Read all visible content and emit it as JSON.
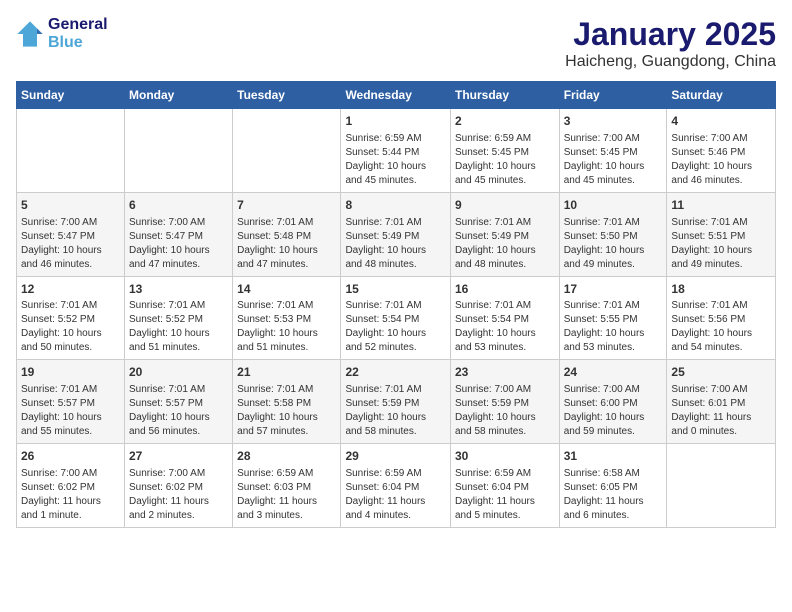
{
  "logo": {
    "line1": "General",
    "line2": "Blue"
  },
  "title": "January 2025",
  "subtitle": "Haicheng, Guangdong, China",
  "days_of_week": [
    "Sunday",
    "Monday",
    "Tuesday",
    "Wednesday",
    "Thursday",
    "Friday",
    "Saturday"
  ],
  "weeks": [
    [
      {
        "day": "",
        "info": ""
      },
      {
        "day": "",
        "info": ""
      },
      {
        "day": "",
        "info": ""
      },
      {
        "day": "1",
        "info": "Sunrise: 6:59 AM\nSunset: 5:44 PM\nDaylight: 10 hours\nand 45 minutes."
      },
      {
        "day": "2",
        "info": "Sunrise: 6:59 AM\nSunset: 5:45 PM\nDaylight: 10 hours\nand 45 minutes."
      },
      {
        "day": "3",
        "info": "Sunrise: 7:00 AM\nSunset: 5:45 PM\nDaylight: 10 hours\nand 45 minutes."
      },
      {
        "day": "4",
        "info": "Sunrise: 7:00 AM\nSunset: 5:46 PM\nDaylight: 10 hours\nand 46 minutes."
      }
    ],
    [
      {
        "day": "5",
        "info": "Sunrise: 7:00 AM\nSunset: 5:47 PM\nDaylight: 10 hours\nand 46 minutes."
      },
      {
        "day": "6",
        "info": "Sunrise: 7:00 AM\nSunset: 5:47 PM\nDaylight: 10 hours\nand 47 minutes."
      },
      {
        "day": "7",
        "info": "Sunrise: 7:01 AM\nSunset: 5:48 PM\nDaylight: 10 hours\nand 47 minutes."
      },
      {
        "day": "8",
        "info": "Sunrise: 7:01 AM\nSunset: 5:49 PM\nDaylight: 10 hours\nand 48 minutes."
      },
      {
        "day": "9",
        "info": "Sunrise: 7:01 AM\nSunset: 5:49 PM\nDaylight: 10 hours\nand 48 minutes."
      },
      {
        "day": "10",
        "info": "Sunrise: 7:01 AM\nSunset: 5:50 PM\nDaylight: 10 hours\nand 49 minutes."
      },
      {
        "day": "11",
        "info": "Sunrise: 7:01 AM\nSunset: 5:51 PM\nDaylight: 10 hours\nand 49 minutes."
      }
    ],
    [
      {
        "day": "12",
        "info": "Sunrise: 7:01 AM\nSunset: 5:52 PM\nDaylight: 10 hours\nand 50 minutes."
      },
      {
        "day": "13",
        "info": "Sunrise: 7:01 AM\nSunset: 5:52 PM\nDaylight: 10 hours\nand 51 minutes."
      },
      {
        "day": "14",
        "info": "Sunrise: 7:01 AM\nSunset: 5:53 PM\nDaylight: 10 hours\nand 51 minutes."
      },
      {
        "day": "15",
        "info": "Sunrise: 7:01 AM\nSunset: 5:54 PM\nDaylight: 10 hours\nand 52 minutes."
      },
      {
        "day": "16",
        "info": "Sunrise: 7:01 AM\nSunset: 5:54 PM\nDaylight: 10 hours\nand 53 minutes."
      },
      {
        "day": "17",
        "info": "Sunrise: 7:01 AM\nSunset: 5:55 PM\nDaylight: 10 hours\nand 53 minutes."
      },
      {
        "day": "18",
        "info": "Sunrise: 7:01 AM\nSunset: 5:56 PM\nDaylight: 10 hours\nand 54 minutes."
      }
    ],
    [
      {
        "day": "19",
        "info": "Sunrise: 7:01 AM\nSunset: 5:57 PM\nDaylight: 10 hours\nand 55 minutes."
      },
      {
        "day": "20",
        "info": "Sunrise: 7:01 AM\nSunset: 5:57 PM\nDaylight: 10 hours\nand 56 minutes."
      },
      {
        "day": "21",
        "info": "Sunrise: 7:01 AM\nSunset: 5:58 PM\nDaylight: 10 hours\nand 57 minutes."
      },
      {
        "day": "22",
        "info": "Sunrise: 7:01 AM\nSunset: 5:59 PM\nDaylight: 10 hours\nand 58 minutes."
      },
      {
        "day": "23",
        "info": "Sunrise: 7:00 AM\nSunset: 5:59 PM\nDaylight: 10 hours\nand 58 minutes."
      },
      {
        "day": "24",
        "info": "Sunrise: 7:00 AM\nSunset: 6:00 PM\nDaylight: 10 hours\nand 59 minutes."
      },
      {
        "day": "25",
        "info": "Sunrise: 7:00 AM\nSunset: 6:01 PM\nDaylight: 11 hours\nand 0 minutes."
      }
    ],
    [
      {
        "day": "26",
        "info": "Sunrise: 7:00 AM\nSunset: 6:02 PM\nDaylight: 11 hours\nand 1 minute."
      },
      {
        "day": "27",
        "info": "Sunrise: 7:00 AM\nSunset: 6:02 PM\nDaylight: 11 hours\nand 2 minutes."
      },
      {
        "day": "28",
        "info": "Sunrise: 6:59 AM\nSunset: 6:03 PM\nDaylight: 11 hours\nand 3 minutes."
      },
      {
        "day": "29",
        "info": "Sunrise: 6:59 AM\nSunset: 6:04 PM\nDaylight: 11 hours\nand 4 minutes."
      },
      {
        "day": "30",
        "info": "Sunrise: 6:59 AM\nSunset: 6:04 PM\nDaylight: 11 hours\nand 5 minutes."
      },
      {
        "day": "31",
        "info": "Sunrise: 6:58 AM\nSunset: 6:05 PM\nDaylight: 11 hours\nand 6 minutes."
      },
      {
        "day": "",
        "info": ""
      }
    ]
  ]
}
